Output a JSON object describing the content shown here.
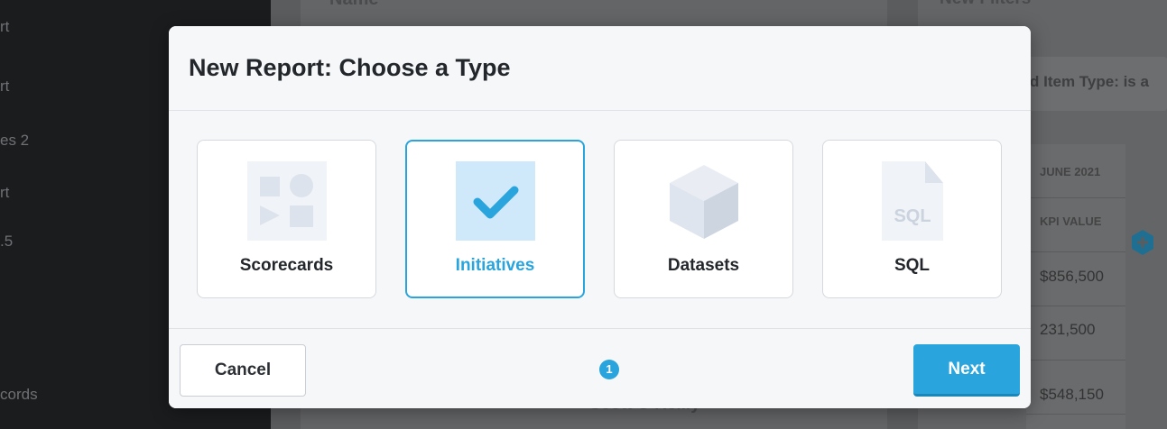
{
  "background": {
    "sidebar_items": [
      "rt",
      "rt",
      "es 2",
      "rt",
      ".5",
      "cords"
    ],
    "header_name": "Name",
    "header_right": "New Filters",
    "filter_text": "d Item Type: is a",
    "table": {
      "headers": [
        "JUNE 2021",
        "KPI VALUE"
      ],
      "values": [
        "$856,500",
        "231,500",
        "$548,150"
      ]
    },
    "row_name": "Scott O'Reilly"
  },
  "modal": {
    "title": "New Report: Choose a Type",
    "types": [
      {
        "label": "Scorecards",
        "icon": "scorecards-shapes-icon",
        "selected": false
      },
      {
        "label": "Initiatives",
        "icon": "checkmark-icon",
        "selected": true
      },
      {
        "label": "Datasets",
        "icon": "cube-icon",
        "selected": false
      },
      {
        "label": "SQL",
        "icon": "sql-file-icon",
        "selected": false
      }
    ],
    "step": "1",
    "cancel_label": "Cancel",
    "next_label": "Next"
  },
  "colors": {
    "accent": "#2aa4dd",
    "icon_muted": "#dde3ec",
    "icon_selected_bg": "#cfe9fa"
  }
}
